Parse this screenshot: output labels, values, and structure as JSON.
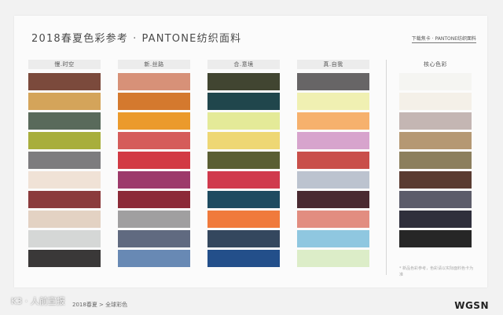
{
  "title": {
    "main": "2018春夏色彩参考",
    "separator": "·",
    "sub": "PANTONE纺织面料"
  },
  "top_right": {
    "text": "下载焦卡 · PANTONE纺织面料"
  },
  "columns": [
    {
      "label": "慢.时空",
      "colors": [
        "#7b4a3c",
        "#d4a45a",
        "#596a5b",
        "#a8ae3c",
        "#7d7c7e",
        "#f0e2d6",
        "#8b3b3c",
        "#e3d2c3",
        "#d5d7d6",
        "#3a3838"
      ]
    },
    {
      "label": "新.丝路",
      "colors": [
        "#d79178",
        "#d4792e",
        "#eb9a2c",
        "#d55c5a",
        "#d23a44",
        "#9d3a6b",
        "#8c2a38",
        "#a09fa0",
        "#606a80",
        "#6889b4"
      ]
    },
    {
      "label": "合.意境",
      "colors": [
        "#414531",
        "#20464c",
        "#e4ea98",
        "#eed774",
        "#5a5e33",
        "#d03a4d",
        "#1e4b60",
        "#f07a3c",
        "#34475e",
        "#234f8a"
      ]
    },
    {
      "label": "真.自我",
      "colors": [
        "#676566",
        "#f0f0b2",
        "#f6b16d",
        "#d7a4cd",
        "#c94f4a",
        "#bcc3cf",
        "#4a2a31",
        "#e28d80",
        "#8fc7e0",
        "#dcedc8"
      ]
    }
  ],
  "core": {
    "label": "核心色彩",
    "colors": [
      "#f5f5f2",
      "#f4f0e8",
      "#c4b6b3",
      "#b59873",
      "#8c7f5d",
      "#5a3b31",
      "#5c5c6a",
      "#2f2f3c",
      "#262626"
    ]
  },
  "note": {
    "text": "* 新品色彩参考，色彩请以实际面料色卡为准"
  },
  "footer": {
    "breadcrumb": "2018春夏 > 全球彩色",
    "watermark": "K3 · 人前宣报"
  },
  "logo": {
    "text": "WGSN"
  }
}
